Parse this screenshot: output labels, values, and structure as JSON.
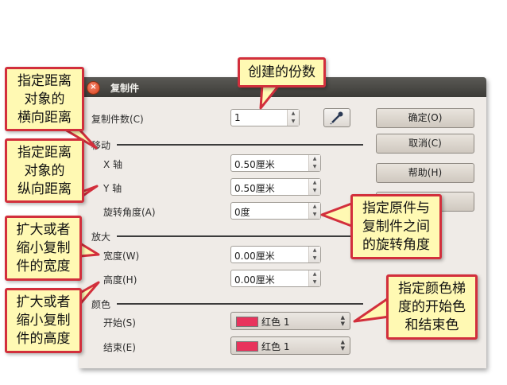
{
  "dialog": {
    "title": "复制件",
    "close_icon": "close-icon",
    "copies": {
      "label": "复制件数(C)",
      "value": "1"
    },
    "move": {
      "section": "移动",
      "x_label": "X 轴",
      "x_value": "0.50厘米",
      "y_label": "Y 轴",
      "y_value": "0.50厘米",
      "angle_label": "旋转角度(A)",
      "angle_value": "0度"
    },
    "enlarge": {
      "section": "放大",
      "width_label": "宽度(W)",
      "width_value": "0.00厘米",
      "height_label": "高度(H)",
      "height_value": "0.00厘米"
    },
    "colors": {
      "section": "颜色",
      "start_label": "开始(S)",
      "start_value": "红色 1",
      "end_label": "结束(E)",
      "end_value": "红色 1",
      "swatch_color": "#e8335c"
    },
    "buttons": {
      "ok": "确定(O)",
      "cancel": "取消(C)",
      "help": "帮助(H)"
    }
  },
  "callouts": {
    "copies": "创建的份数",
    "x_distance": [
      "指定距离",
      "对象的",
      "横向距离"
    ],
    "y_distance": [
      "指定距离",
      "对象的",
      "纵向距离"
    ],
    "width": [
      "扩大或者",
      "缩小复制",
      "件的宽度"
    ],
    "height": [
      "扩大或者",
      "缩小复制",
      "件的高度"
    ],
    "angle": [
      "指定原件与",
      "复制件之间",
      "的旋转角度"
    ],
    "color": [
      "指定颜色梯",
      "度的开始色",
      "和结束色"
    ]
  },
  "colors": {
    "callout_fill": "#fff9b3",
    "callout_border": "#d22f3c",
    "titlebar": "#3c3b37"
  }
}
